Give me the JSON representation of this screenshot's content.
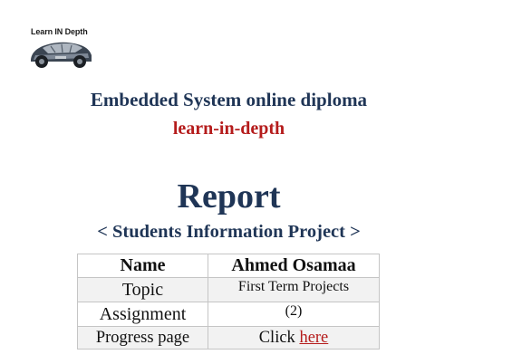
{
  "logo": {
    "text": "Learn IN Depth",
    "icon": "car-icon"
  },
  "header": {
    "diploma": "Embedded System online diploma",
    "brand": "learn-in-depth"
  },
  "report": {
    "title": "Report",
    "subtitle": "< Students Information Project >"
  },
  "table": {
    "name_label": "Name",
    "name_value": "Ahmed Osamaa",
    "topic_label": "Topic",
    "topic_value": "First Term Projects",
    "assignment_label": "Assignment",
    "assignment_value": "(2)",
    "progress_label": "Progress page",
    "progress_prefix": "Click",
    "progress_link": "here"
  },
  "colors": {
    "navy": "#1f3556",
    "red": "#b51c1c",
    "row_alt": "#f2f2f2",
    "border": "#c5c5c5"
  }
}
